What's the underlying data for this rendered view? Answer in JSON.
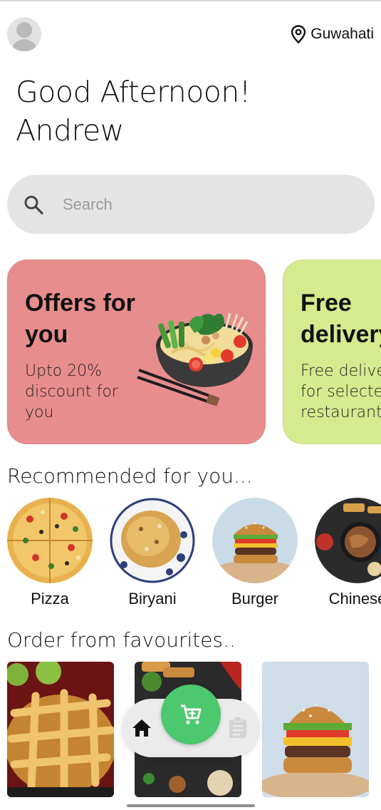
{
  "header": {
    "avatar_icon": "user-avatar-icon",
    "location_icon": "map-pin-icon",
    "location": "Guwahati"
  },
  "greeting": {
    "line1": "Good Afternoon!",
    "line2": "Andrew"
  },
  "search": {
    "icon": "search-icon",
    "placeholder": "Search"
  },
  "offers": [
    {
      "title_line1": "Offers for",
      "title_line2": "you",
      "sub_line1": "Upto 20%",
      "sub_line2": "discount for",
      "sub_line3": "you",
      "color": "#e88d8d"
    },
    {
      "title_line1": "Free",
      "title_line2": "delivery",
      "sub_line1": "Free delivery",
      "sub_line2": "for selected",
      "sub_line3": "restaurants",
      "color": "#d6ea8e"
    }
  ],
  "recommended": {
    "title": "Recommended for you...",
    "items": [
      {
        "label": "Pizza"
      },
      {
        "label": "Biryani"
      },
      {
        "label": "Burger"
      },
      {
        "label": "Chinese"
      }
    ]
  },
  "favourites": {
    "title": "Order from favourites.."
  },
  "navbar": {
    "home_icon": "home-icon",
    "cart_icon": "cart-icon",
    "orders_icon": "clipboard-icon",
    "accent": "#4cc86e"
  }
}
